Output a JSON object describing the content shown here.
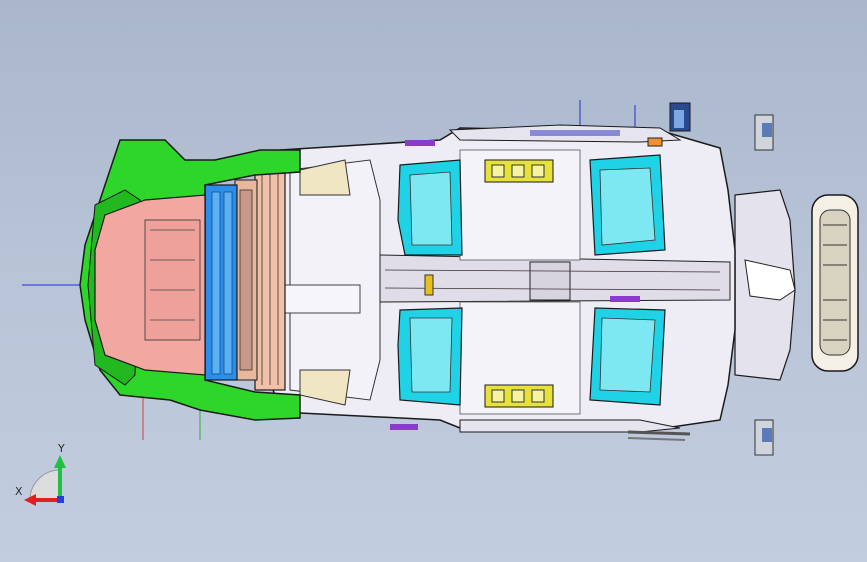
{
  "viewport": {
    "background_top": "#a9b6cc",
    "background_bottom": "#c3cde0"
  },
  "model": {
    "description_icon": "car-body-assembly-top-view",
    "colors": {
      "front_module": "#2fd62a",
      "front_panel": "#f2a7a0",
      "radiator": "#2b8ee8",
      "body_white": "#eceaf4",
      "seat_cyan": "#1fd2e6",
      "bracket_yellow": "#e6e23a",
      "outline": "#1a1a1a",
      "purple_accent": "#8a3cc8",
      "orange_accent": "#f09030"
    }
  },
  "triad": {
    "x_label": "X",
    "y_label": "Y",
    "x_color": "#e02020",
    "y_color": "#20c040",
    "z_color": "#2040e0"
  }
}
